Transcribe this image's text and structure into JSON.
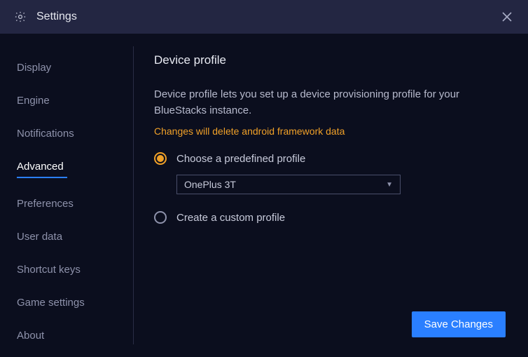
{
  "titlebar": {
    "title": "Settings"
  },
  "sidebar": {
    "items": [
      {
        "label": "Display"
      },
      {
        "label": "Engine"
      },
      {
        "label": "Notifications"
      },
      {
        "label": "Advanced"
      },
      {
        "label": "Preferences"
      },
      {
        "label": "User data"
      },
      {
        "label": "Shortcut keys"
      },
      {
        "label": "Game settings"
      },
      {
        "label": "About"
      }
    ],
    "active_index": 3
  },
  "main": {
    "section_title": "Device profile",
    "description": "Device profile lets you set up a device provisioning profile for your BlueStacks instance.",
    "warning": "Changes will delete android framework data",
    "options": {
      "predefined_label": "Choose a predefined profile",
      "custom_label": "Create a custom profile",
      "selected": "predefined"
    },
    "dropdown": {
      "value": "OnePlus 3T"
    }
  },
  "footer": {
    "save_label": "Save Changes"
  }
}
